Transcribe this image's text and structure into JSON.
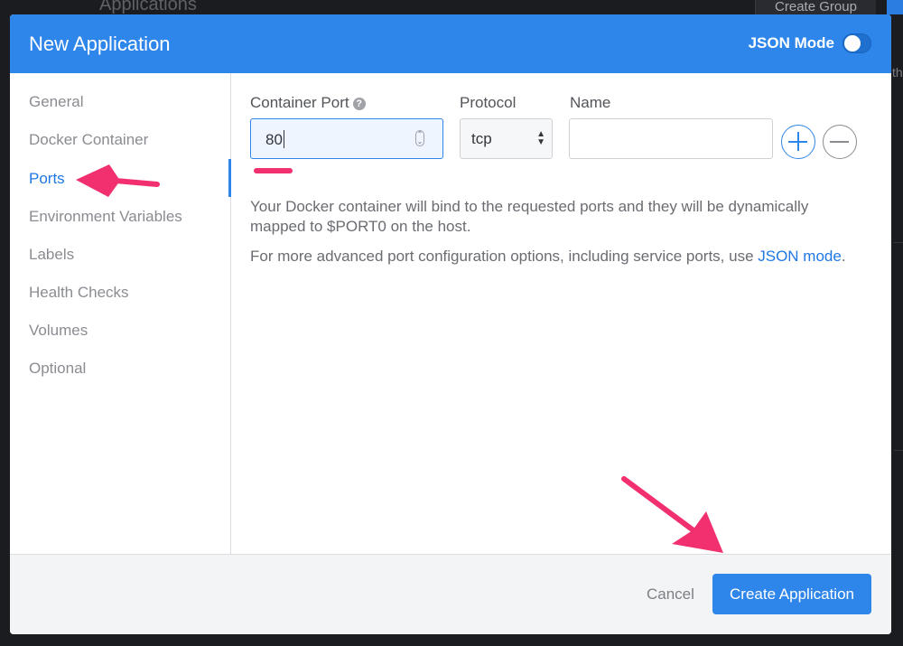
{
  "background": {
    "title": "Applications",
    "create_group_label": "Create Group",
    "fragment_text": "th"
  },
  "modal": {
    "title": "New Application",
    "json_mode_label": "JSON Mode",
    "json_mode_on": false
  },
  "sidebar": {
    "items": [
      {
        "label": "General",
        "active": false
      },
      {
        "label": "Docker Container",
        "active": false
      },
      {
        "label": "Ports",
        "active": true
      },
      {
        "label": "Environment Variables",
        "active": false
      },
      {
        "label": "Labels",
        "active": false
      },
      {
        "label": "Health Checks",
        "active": false
      },
      {
        "label": "Volumes",
        "active": false
      },
      {
        "label": "Optional",
        "active": false
      }
    ]
  },
  "ports": {
    "container_port_label": "Container Port",
    "container_port_value": "80",
    "protocol_label": "Protocol",
    "protocol_value": "tcp",
    "name_label": "Name",
    "name_value": "",
    "help_icon_glyph": "?",
    "description_1": "Your Docker container will bind to the requested ports and they will be dynamically mapped to $PORT0 on the host.",
    "description_2_prefix": "For more advanced port configuration options, including service ports, use ",
    "description_2_link": "JSON mode",
    "description_2_suffix": "."
  },
  "footer": {
    "cancel_label": "Cancel",
    "create_label": "Create Application"
  },
  "colors": {
    "accent": "#2f86ea",
    "annotation": "#f2306f"
  },
  "icons": [
    "help-icon",
    "spinner-icon",
    "select-arrows-icon",
    "plus-circle-icon",
    "minus-circle-icon",
    "annotation-arrow"
  ]
}
